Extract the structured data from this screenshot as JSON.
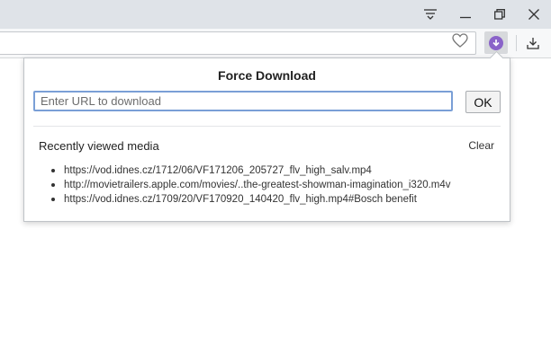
{
  "window": {
    "menu_icon": "hamburger-filter-icon",
    "minimize_icon": "minimize-icon",
    "maximize_icon": "restore-icon",
    "close_icon": "close-icon"
  },
  "toolbar": {
    "bookmark_icon": "heart-icon",
    "extension_icon": "force-download-icon",
    "download_icon": "download-icon",
    "extension_color": "#8a63c9"
  },
  "popup": {
    "title": "Force Download",
    "url_placeholder": "Enter URL to download",
    "url_value": "",
    "ok_label": "OK",
    "recent_title": "Recently viewed media",
    "clear_label": "Clear",
    "recent_items": [
      "https://vod.idnes.cz/1712/06/VF171206_205727_flv_high_salv.mp4",
      "http://movietrailers.apple.com/movies/..the-greatest-showman-imagination_i320.m4v",
      "https://vod.idnes.cz/1709/20/VF170920_140420_flv_high.mp4#Bosch benefit"
    ]
  }
}
